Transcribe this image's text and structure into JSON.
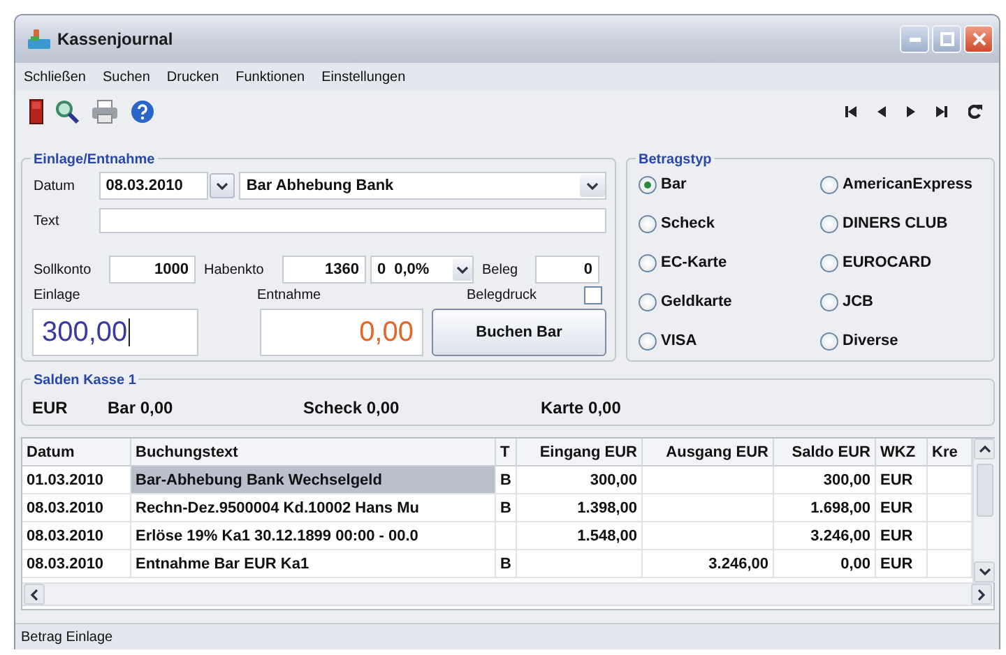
{
  "window": {
    "title": "Kassenjournal"
  },
  "menu": [
    "Schließen",
    "Suchen",
    "Drucken",
    "Funktionen",
    "Einstellungen"
  ],
  "einlage_entnahme": {
    "title": "Einlage/Entnahme",
    "datum_label": "Datum",
    "datum": "08.03.2010",
    "buchung": "Bar Abhebung Bank",
    "text_label": "Text",
    "sollkonto_label": "Sollkonto",
    "sollkonto": "1000",
    "habenkto_label": "Habenkto",
    "habenkto": "1360",
    "steuer_code": "0",
    "steuer_satz": "0,0%",
    "beleg_label": "Beleg",
    "beleg": "0",
    "einlage_label": "Einlage",
    "entnahme_label": "Entnahme",
    "belegdruck_label": "Belegdruck",
    "belegdruck_checked": false,
    "einlage": "300,00",
    "entnahme": "0,00",
    "button": "Buchen Bar"
  },
  "betragstyp": {
    "title": "Betragstyp",
    "options": [
      {
        "label": "Bar",
        "selected": true
      },
      {
        "label": "AmericanExpress",
        "selected": false
      },
      {
        "label": "Scheck",
        "selected": false
      },
      {
        "label": "DINERS CLUB",
        "selected": false
      },
      {
        "label": "EC-Karte",
        "selected": false
      },
      {
        "label": "EUROCARD",
        "selected": false
      },
      {
        "label": "Geldkarte",
        "selected": false
      },
      {
        "label": "JCB",
        "selected": false
      },
      {
        "label": "VISA",
        "selected": false
      },
      {
        "label": "Diverse",
        "selected": false
      }
    ]
  },
  "salden": {
    "title": "Salden Kasse 1",
    "items": [
      "EUR",
      "Bar 0,00",
      "Scheck 0,00",
      "Karte 0,00"
    ]
  },
  "table": {
    "columns": [
      "Datum",
      "Buchungstext",
      "T",
      "Eingang EUR",
      "Ausgang EUR",
      "Saldo EUR",
      "WKZ",
      "Kre"
    ],
    "rows": [
      {
        "datum": "01.03.2010",
        "buchungstext": "Bar-Abhebung Bank Wechselgeld",
        "t": "B",
        "eingang": "300,00",
        "saldo": "300,00",
        "wkz": "EUR",
        "selected": true
      },
      {
        "datum": "08.03.2010",
        "buchungstext": "Rechn-Dez.9500004 Kd.10002 Hans Mu",
        "t": "B",
        "eingang": "1.398,00",
        "saldo": "1.698,00",
        "wkz": "EUR",
        "selected": false
      },
      {
        "datum": "08.03.2010",
        "buchungstext": "Erlöse 19% Ka1 30.12.1899 00:00 - 00.0",
        "eingang": "1.548,00",
        "saldo": "3.246,00",
        "wkz": "EUR",
        "selected": false
      },
      {
        "datum": "08.03.2010",
        "buchungstext": "Entnahme Bar EUR Ka1",
        "t": "B",
        "ausgang": "3.246,00",
        "saldo": "0,00",
        "wkz": "EUR",
        "selected": false
      }
    ]
  },
  "status_bar": "Betrag Einlage"
}
